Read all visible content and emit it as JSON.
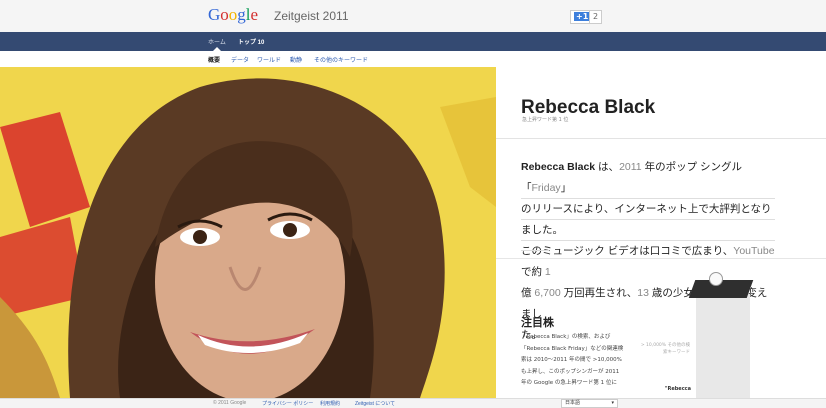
{
  "header": {
    "logo_letters": [
      {
        "ch": "G",
        "color": "#3367d6"
      },
      {
        "ch": "o",
        "color": "#d32f2f"
      },
      {
        "ch": "o",
        "color": "#f4b400"
      },
      {
        "ch": "g",
        "color": "#3367d6"
      },
      {
        "ch": "l",
        "color": "#0f9d58"
      },
      {
        "ch": "e",
        "color": "#d32f2f"
      }
    ],
    "title": "Zeitgeist 2011",
    "plus_label": "+1",
    "plus_count": "2"
  },
  "nav": {
    "items": [
      {
        "label": "ホーム",
        "active": false
      },
      {
        "label": "トップ 10",
        "active": true
      }
    ]
  },
  "subnav": {
    "items": [
      {
        "label": "概要",
        "selected": true
      },
      {
        "label": "データ",
        "selected": false
      },
      {
        "label": "ワールド",
        "selected": false
      },
      {
        "label": "動静",
        "selected": false
      },
      {
        "label": "その他のキーワード",
        "selected": false
      }
    ]
  },
  "profile": {
    "name": "Rebecca Black",
    "rank": "急上昇ワード第 1 位",
    "description_lines": [
      [
        "Rebecca Black",
        " は、",
        "2011",
        " 年のポップ シングル「",
        "Friday",
        "」"
      ],
      [
        "のリリースにより、インターネット上で大評判となりました。"
      ],
      [
        "このミュージック ビデオは口コミで広まり、",
        "YouTube",
        " で約 ",
        "1"
      ],
      [
        "億 ",
        "6,700",
        " 万回再生され、",
        "13",
        " 歳の少女を有名人に変えまし"
      ],
      [
        "た。"
      ]
    ]
  },
  "notable": {
    "title": "注目株",
    "lines": [
      "「Rebecca Black」の検索、および",
      "「Rebecca Black Friday」などの関連検",
      "索は 2010～2011 年の間で >10,000%",
      "も上昇し、このポップシンガーが 2011",
      "年の Google の急上昇ワード第 1 位に"
    ],
    "pillar_label": "> 10,000% その他の検索キーワード",
    "pillar_name": "\"Rebecca"
  },
  "footer": {
    "copyright": "© 2011 Google",
    "links": [
      "プライバシー ポリシー",
      "利用規約",
      "Zeitgeist について"
    ],
    "language": "日本語"
  },
  "colors": {
    "nav_bg": "#344a72",
    "link": "#2f5db1",
    "photo_bg": "#f1d64a"
  }
}
